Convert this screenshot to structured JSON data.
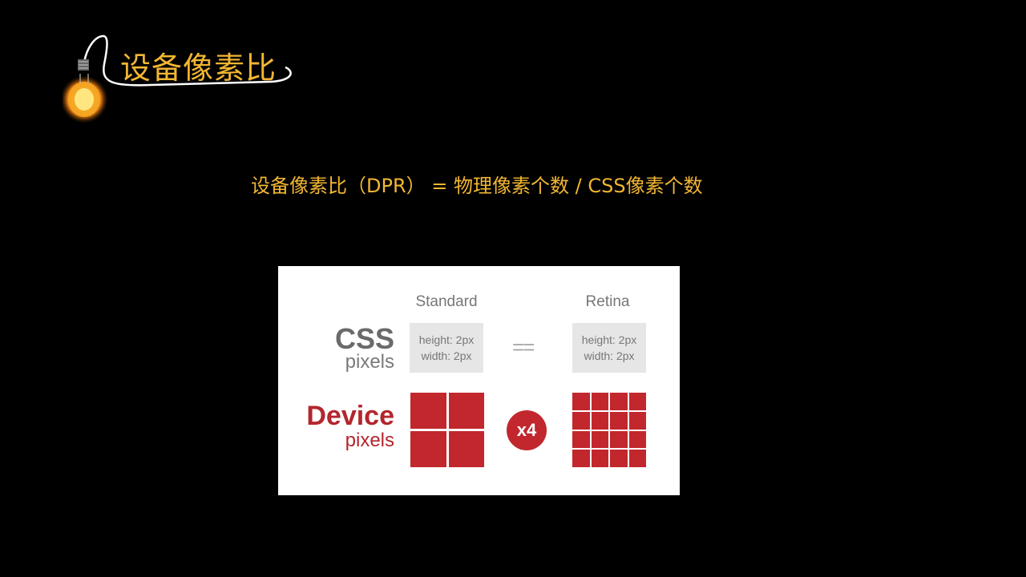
{
  "header": {
    "title": "设备像素比"
  },
  "formula": {
    "text": "设备像素比（DPR） = 物理像素个数 / CSS像素个数"
  },
  "diagram": {
    "columns": {
      "standard": "Standard",
      "retina": "Retina"
    },
    "rows": {
      "css": {
        "main": "CSS",
        "sub": "pixels"
      },
      "device": {
        "main": "Device",
        "sub": "pixels"
      }
    },
    "standard_box": {
      "height": "height: 2px",
      "width": "width: 2px"
    },
    "retina_box": {
      "height": "height: 2px",
      "width": "width: 2px"
    },
    "equals": "==",
    "multiplier": "x4",
    "standard_grid_cells": 4,
    "retina_grid_cells": 16,
    "colors": {
      "accent": "#f2b632",
      "device_red": "#c1272d",
      "gray_text": "#777777",
      "box_gray": "#e6e6e6"
    }
  },
  "icons": [
    "light-bulb-icon"
  ]
}
